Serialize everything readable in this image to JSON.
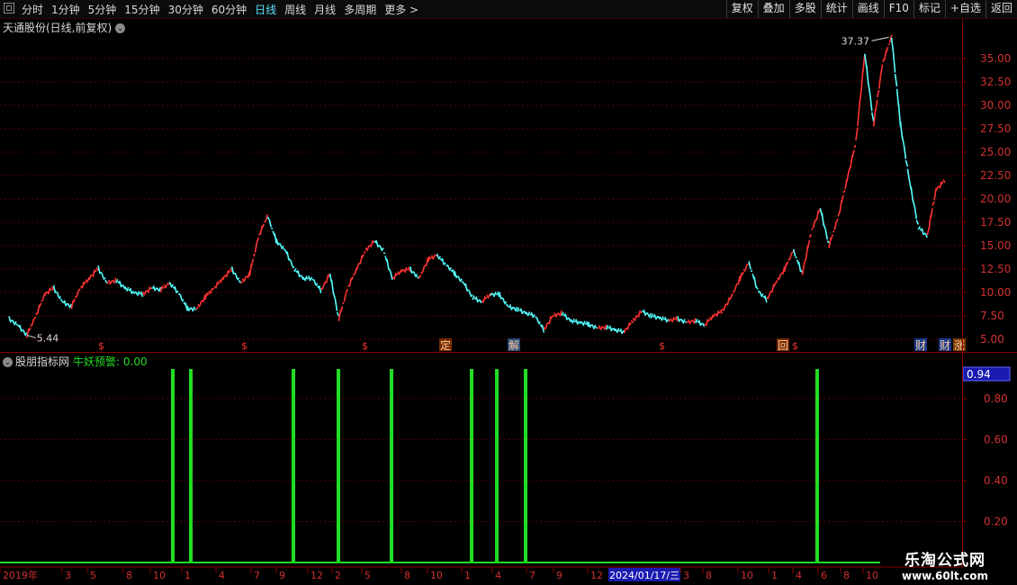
{
  "toolbar": {
    "periods": [
      "分时",
      "1分钟",
      "5分钟",
      "15分钟",
      "30分钟",
      "60分钟",
      "日线",
      "周线",
      "月线",
      "多周期",
      "更多 >"
    ],
    "active_period": "日线",
    "tools": [
      "复权",
      "叠加",
      "多股",
      "统计",
      "画线",
      "F10",
      "标记",
      "+自选",
      "返回"
    ]
  },
  "main_panel": {
    "title": "天通股份(日线,前复权)",
    "high_label": "37.37",
    "low_label": "5.44",
    "price_ticks": [
      "35.00",
      "32.50",
      "30.00",
      "27.50",
      "25.00",
      "22.50",
      "20.00",
      "17.50",
      "15.00",
      "12.50",
      "10.00",
      "7.50",
      "5.00"
    ],
    "markers": [
      "$",
      "$",
      "$",
      "定",
      "解",
      "$",
      "回",
      "$",
      "财",
      "财",
      "涨"
    ]
  },
  "indicator_panel": {
    "name": "股朋指标网",
    "label": "牛妖预警: 0.00",
    "value_badge": "0.94",
    "ticks": [
      "0.80",
      "0.60",
      "0.40",
      "0.20"
    ]
  },
  "x_axis": {
    "labels": [
      "2019年",
      "3",
      "5",
      "8",
      "10",
      "1",
      "4",
      "7",
      "9",
      "12",
      "2",
      "5",
      "8",
      "10",
      "1",
      "4",
      "7",
      "9",
      "12",
      "2024/01/17/三",
      "3",
      "8",
      "10",
      "1",
      "4",
      "6",
      "8",
      "10"
    ]
  },
  "watermark": {
    "line1": "乐淘公式网",
    "line2": "www.60lt.com"
  },
  "colors": {
    "up": "#ff3333",
    "down": "#54ffff",
    "signal": "#22dd22",
    "grid": "#5a0000",
    "badge": "#1a1ab0"
  },
  "chart_data": {
    "type": "line",
    "series": [
      {
        "values": [
          7.2,
          6.5,
          5.44,
          7.5,
          9.8,
          10.5,
          9,
          8.5,
          10.5,
          11.5,
          12.6,
          11,
          11.3,
          10.5,
          10,
          9.8,
          10.5,
          10.3,
          11,
          10,
          8.3,
          8.2,
          9.5,
          10.5,
          11.5,
          12.5,
          11,
          12,
          16,
          18.2,
          15.5,
          14.5,
          12.5,
          11.5,
          11.5,
          10.2,
          12,
          7.2,
          10.5,
          12.5,
          14.5,
          15.5,
          14.5,
          11.5,
          12.3,
          12.5,
          11.5,
          13.5,
          14,
          13,
          12,
          11,
          9.5,
          9,
          9.8,
          9.8,
          8.5,
          8.2,
          7.8,
          7.5,
          6,
          7.5,
          7.8,
          7,
          6.8,
          6.6,
          6.2,
          6.3,
          6,
          5.8,
          7,
          8,
          7.5,
          7.3,
          7,
          7.2,
          6.8,
          7,
          6.5,
          7.5,
          8,
          9.5,
          11.5,
          13.2,
          10.2,
          9.2,
          11,
          12.5,
          14.5,
          12,
          16.5,
          19,
          15,
          18,
          22,
          26,
          35.5,
          28,
          34.5,
          37.37,
          28,
          22,
          17,
          16,
          21,
          22
        ]
      }
    ],
    "signal_bars": [
      0.94,
      0.94,
      0.94,
      0.94,
      0.94,
      0.94,
      0.94,
      0.94,
      0.94
    ],
    "ylim": [
      5,
      37.37
    ]
  }
}
